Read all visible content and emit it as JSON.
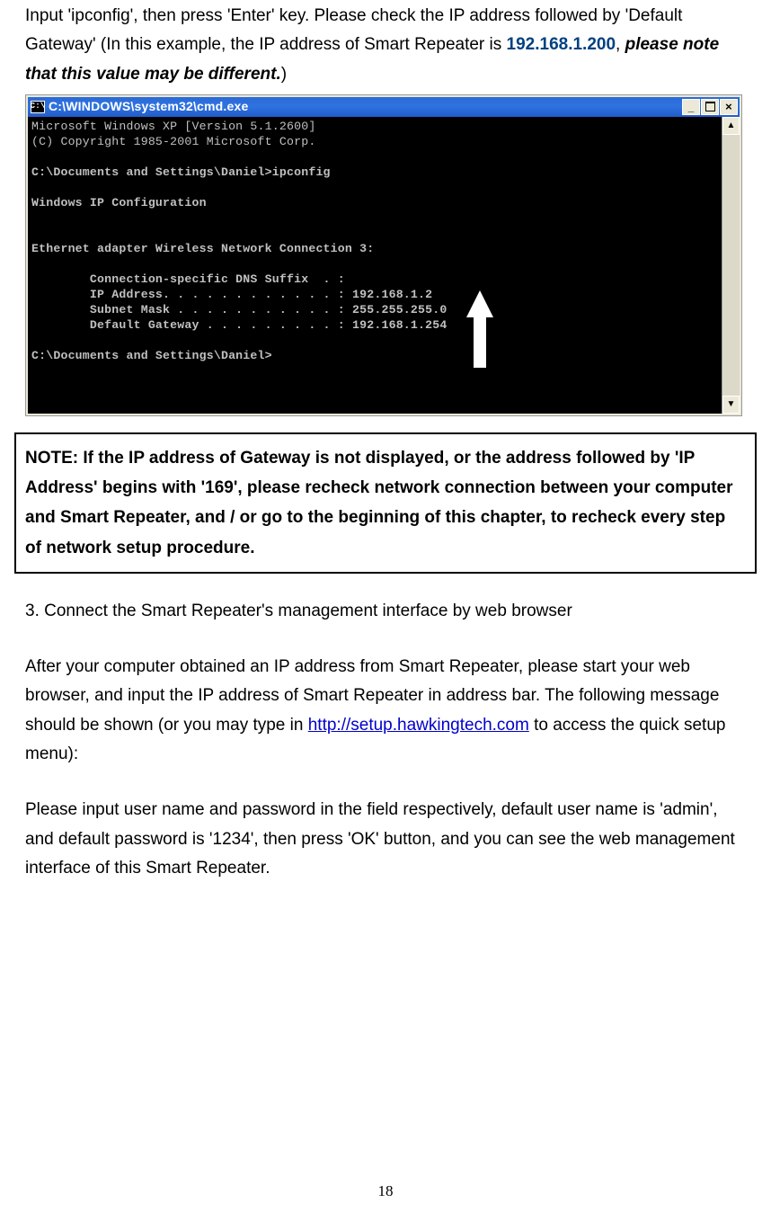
{
  "intro": {
    "p1a": "Input 'ipconfig', then press 'Enter' key. Please check the IP address followed by 'Default Gateway' (In this example, the IP address of Smart Repeater is ",
    "ip": "192.168.1.200",
    "sep": ", ",
    "p1b": "please note that this value may be different.",
    "close": ")"
  },
  "cmd": {
    "title_icon": "C:\\",
    "title": "C:\\WINDOWS\\system32\\cmd.exe",
    "min": "_",
    "close": "×",
    "sb_up": "▲",
    "sb_down": "▼",
    "l01": "Microsoft Windows XP [Version 5.1.2600]",
    "l02": "(C) Copyright 1985-2001 Microsoft Corp.",
    "l03": "",
    "l04": "C:\\Documents and Settings\\Daniel>ipconfig",
    "l05": "",
    "l06": "Windows IP Configuration",
    "l07": "",
    "l08": "",
    "l09": "Ethernet adapter Wireless Network Connection 3:",
    "l10": "",
    "l11": "        Connection-specific DNS Suffix  . :",
    "l12": "        IP Address. . . . . . . . . . . . : 192.168.1.2",
    "l13": "        Subnet Mask . . . . . . . . . . . : 255.255.255.0",
    "l14": "        Default Gateway . . . . . . . . . : 192.168.1.254",
    "l15": "",
    "l16": "C:\\Documents and Settings\\Daniel>"
  },
  "note": "NOTE: If the IP address of Gateway is not displayed, or the address followed by 'IP Address' begins with '169', please recheck network connection between your computer and Smart Repeater, and / or go to the beginning of this chapter, to recheck every step of network setup procedure.",
  "step3": {
    "heading": "3. Connect the Smart Repeater's management interface by web browser",
    "p1a": "After your computer obtained an IP address from Smart Repeater, please start your web browser, and input the IP address of Smart Repeater in address bar. The following message should be shown (or you may type in ",
    "link": "http://setup.hawkingtech.com",
    "p1b": " to access the quick setup menu):",
    "p2": "Please input user name and password in the field respectively, default user name is 'admin', and default password is '1234', then press 'OK' button, and you can see the web management interface of this Smart Repeater."
  },
  "page_number": "18"
}
